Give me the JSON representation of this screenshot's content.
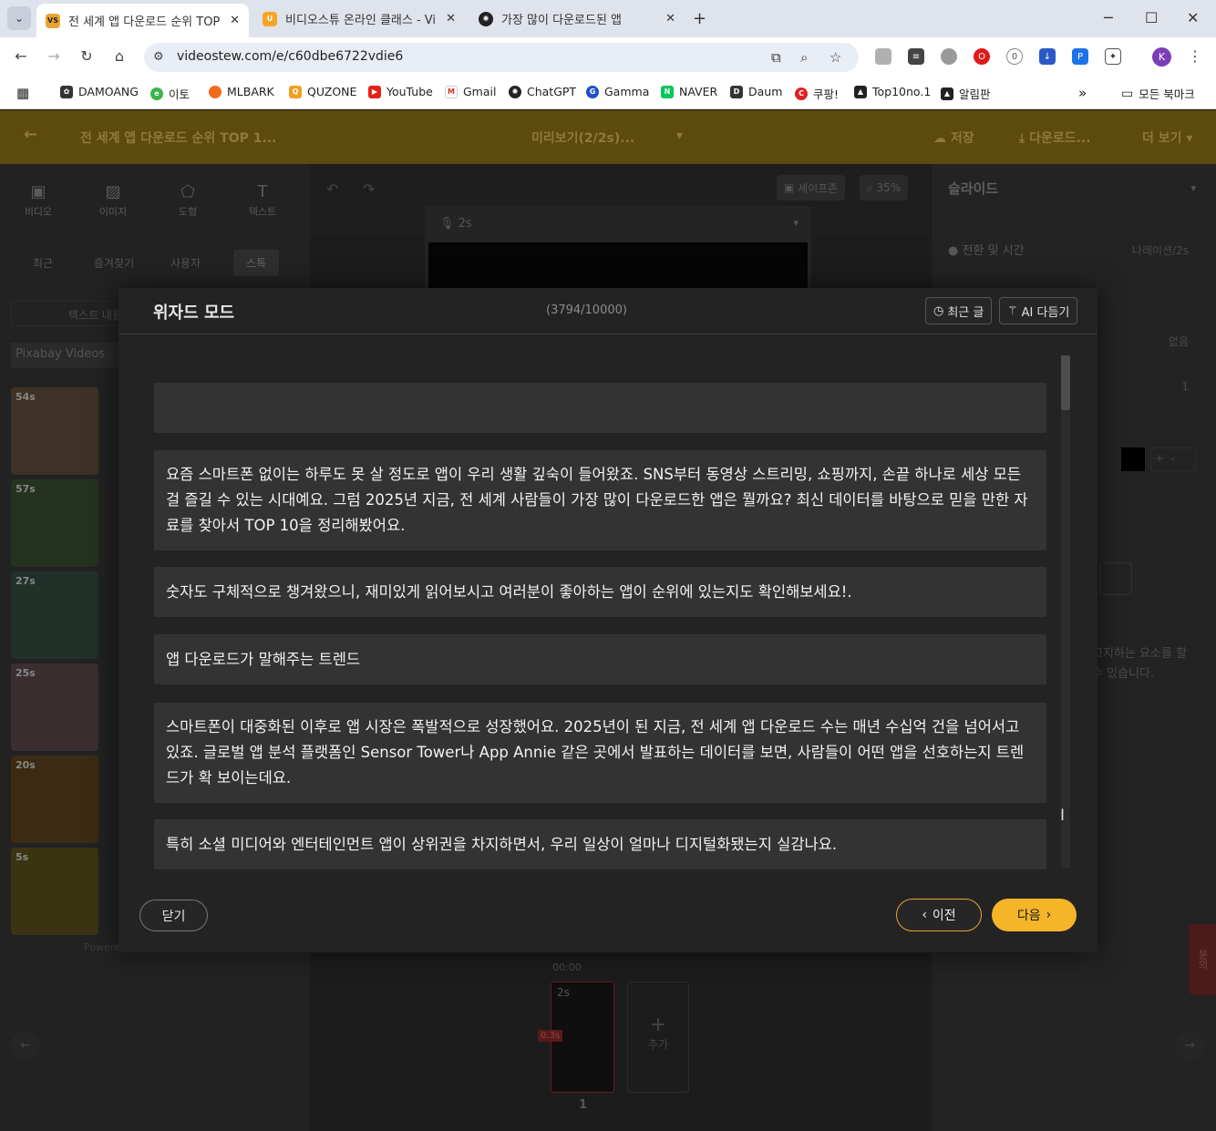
{
  "browser": {
    "tabs": [
      {
        "title": "전 세계 앱 다운로드 순위 TOP",
        "favicon": "VS",
        "color": "#e8a531",
        "active": true
      },
      {
        "title": "비디오스튜 온라인 클래스 - Vi",
        "favicon": "U",
        "color": "#f5a623",
        "active": false
      },
      {
        "title": "가장 많이 다운로드된 앱",
        "favicon": "gpt-icon",
        "color": "#222222",
        "active": false
      }
    ],
    "url": "videostew.com/e/c60dbe6722vdie6",
    "bookmarks": [
      "DAMOANG",
      "이토",
      "MLBARK",
      "QUZONE",
      "YouTube",
      "Gmail",
      "ChatGPT",
      "Gamma",
      "NAVER",
      "Daum",
      "쿠팡!",
      "Top10no.1",
      "알림판"
    ],
    "all_bookmarks": "모든 북마크",
    "profile_initial": "K"
  },
  "app": {
    "project_title": "전 세계 앱 다운로드 순위 TOP 1...",
    "preview_label": "미리보기(2/2s)...",
    "save_label": "저장",
    "download_label": "다운로드...",
    "more_label": "더 보기",
    "left_icons": [
      "비디오",
      "이미지",
      "도형",
      "텍스트"
    ],
    "left_tabs": [
      "최근",
      "즐겨찾기",
      "사용자",
      "스톡"
    ],
    "text_search": "텍스트 내용",
    "source_select": "Pixabay Videos",
    "thumb_durations": [
      "54s",
      "57s",
      "27s",
      "25s",
      "20s",
      "5s"
    ],
    "shape_zone": "세이프존",
    "zoom": "35%",
    "clip_duration": "2s",
    "right_title": "슬라이드",
    "transition_label": "전환 및 시간",
    "transition_value": "나레이션/2s",
    "none_value": "없음",
    "count_value": "1",
    "hint_text": "고지하는 요소를 할 수 있습니다.",
    "timeline_time": "00:00",
    "timeline_clip": "2s",
    "timeline_red": "0.3s",
    "timeline_add": "추가",
    "slide_number": "1",
    "powered": "Powere",
    "side_tab": "문의"
  },
  "modal": {
    "title": "위자드 모드",
    "char_count": "(3794/10000)",
    "recent_btn": "최근 글",
    "ai_btn": "AI 다듬기",
    "paragraphs": [
      "",
      "요즘 스마트폰 없이는 하루도 못 살 정도로 앱이 우리 생활 깊숙이 들어왔죠. SNS부터 동영상 스트리밍, 쇼핑까지, 손끝 하나로 세상 모든 걸 즐길 수 있는 시대예요. 그럼 2025년 지금, 전 세계 사람들이 가장 많이 다운로드한 앱은 뭘까요? 최신 데이터를 바탕으로 믿을 만한 자료를 찾아서 TOP 10을 정리해봤어요.",
      "숫자도 구체적으로 챙겨왔으니, 재미있게 읽어보시고 여러분이 좋아하는 앱이 순위에 있는지도 확인해보세요!.",
      "앱 다운로드가 말해주는 트렌드",
      "스마트폰이 대중화된 이후로 앱 시장은 폭발적으로 성장했어요. 2025년이 된 지금, 전 세계 앱 다운로드 수는 매년 수십억 건을 넘어서고 있죠. 글로벌 앱 분석 플랫폼인 Sensor Tower나 App Annie 같은 곳에서 발표하는 데이터를 보면, 사람들이 어떤 앱을 선호하는지 트렌드가 확 보이는데요.",
      "특히 소셜 미디어와 엔터테인먼트 앱이 상위권을 차지하면서, 우리 일상이 얼마나 디지털화됐는지 실감나요."
    ],
    "close_btn": "닫기",
    "prev_btn": "이전",
    "next_btn": "다음",
    "accent": "#f5b529"
  }
}
